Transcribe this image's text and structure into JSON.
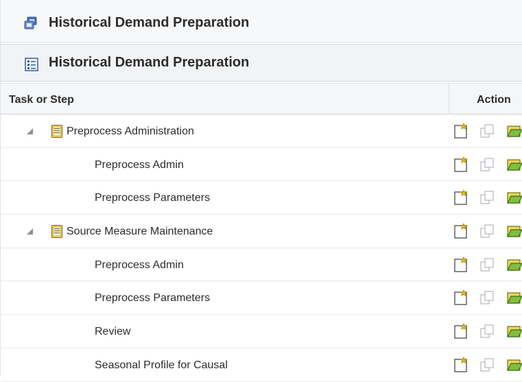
{
  "header": {
    "title": "Historical Demand Preparation",
    "subtitle": "Historical Demand Preparation"
  },
  "table": {
    "columns": {
      "task": "Task or Step",
      "action": "Action"
    },
    "rows": [
      {
        "kind": "parent",
        "label": "Preprocess Administration"
      },
      {
        "kind": "child",
        "label": "Preprocess Admin"
      },
      {
        "kind": "child",
        "label": "Preprocess Parameters"
      },
      {
        "kind": "parent",
        "label": "Source Measure Maintenance"
      },
      {
        "kind": "child",
        "label": "Preprocess Admin"
      },
      {
        "kind": "child",
        "label": "Preprocess Parameters"
      },
      {
        "kind": "child",
        "label": "Review"
      },
      {
        "kind": "child",
        "label": "Seasonal Profile for Causal"
      }
    ]
  },
  "icons": {
    "header_icon": "process-icon",
    "subheader_icon": "list-icon",
    "row_parent_icon": "clipboard-icon",
    "expander": "expanded-triangle-icon",
    "actions": [
      "new-workbook-icon",
      "copy-workbook-icon",
      "open-workbook-icon"
    ]
  },
  "colors": {
    "accent_blue": "#3a6ab8",
    "folder_yellow": "#f2d35a",
    "folder_green": "#7fbf3f"
  }
}
